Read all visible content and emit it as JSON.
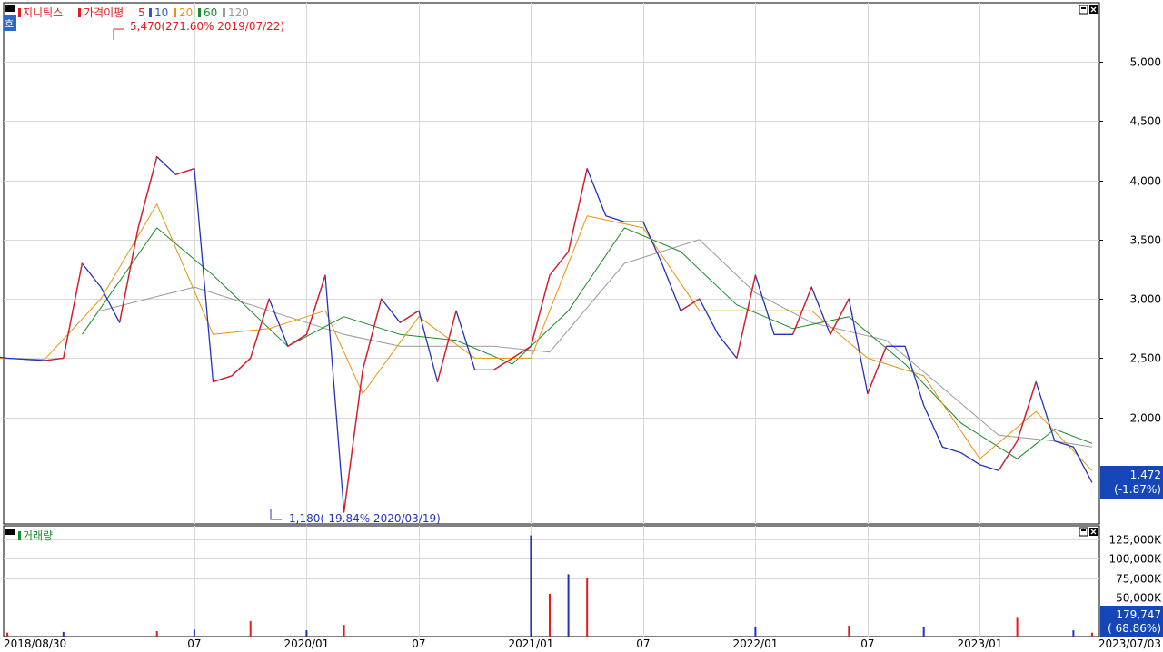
{
  "price_panel": {
    "title": "지니틱스",
    "indicator_label": "가격이평",
    "ma_labels": [
      "5",
      "10",
      "20",
      "60",
      "120"
    ],
    "side_label": "호",
    "high_annotation": "5,470(271.60% 2019/07/22)",
    "low_annotation": "1,180(-19.84% 2020/03/19)",
    "last_price": "1,472",
    "last_change": "(-1.87%)"
  },
  "volume_panel": {
    "title": "거래량",
    "last_volume": "179,747",
    "last_volume_pct": "( 68.86%)"
  },
  "colors": {
    "up": "#e8191e",
    "down": "#2233bb",
    "ma5": "#3355cc",
    "ma10": "#3355cc",
    "ma20": "#e8930c",
    "ma60": "#1a8a2a",
    "ma120": "#999999",
    "badge": "#1547b8",
    "grid": "#d9d9d9"
  },
  "chart_data": [
    {
      "type": "line",
      "title": "지니틱스",
      "ylim": [
        1100,
        5500
      ],
      "y_ticks": [
        2000,
        2500,
        3000,
        3500,
        4000,
        4500,
        5000
      ],
      "y_tick_labels": [
        "2,000",
        "2,500",
        "3,000",
        "3,500",
        "4,000",
        "4,500",
        "5,000"
      ],
      "x_tick_labels": [
        "2018/08/30",
        "07",
        "2020/01",
        "07",
        "2021/01",
        "07",
        "2022/01",
        "07",
        "2023/01",
        "2023/07/03"
      ],
      "grid": true,
      "series": [
        {
          "name": "5",
          "x": [
            "2018/08",
            "2018/09",
            "2018/10",
            "2018/11",
            "2018/12",
            "2019/01",
            "2019/02",
            "2019/03",
            "2019/04",
            "2019/05",
            "2019/06",
            "2019/07",
            "2019/08",
            "2019/09",
            "2019/10",
            "2019/11",
            "2019/12",
            "2020/01",
            "2020/02",
            "2020/03",
            "2020/04",
            "2020/05",
            "2020/06",
            "2020/07",
            "2020/08",
            "2020/09",
            "2020/10",
            "2020/11",
            "2020/12",
            "2021/01",
            "2021/02",
            "2021/03",
            "2021/04",
            "2021/05",
            "2021/06",
            "2021/07",
            "2021/08",
            "2021/09",
            "2021/10",
            "2021/11",
            "2021/12",
            "2022/01",
            "2022/02",
            "2022/03",
            "2022/04",
            "2022/05",
            "2022/06",
            "2022/07",
            "2022/08",
            "2022/09",
            "2022/10",
            "2022/11",
            "2022/12",
            "2023/01",
            "2023/02",
            "2023/03",
            "2023/04",
            "2023/05",
            "2023/06",
            "2023/07"
          ],
          "values": [
            2520,
            2500,
            2490,
            2480,
            2500,
            3300,
            3100,
            2800,
            3600,
            4200,
            4050,
            4100,
            2300,
            2350,
            2500,
            3000,
            2600,
            2700,
            3200,
            1200,
            2400,
            3000,
            2800,
            2900,
            2300,
            2900,
            2400,
            2400,
            2500,
            2600,
            3200,
            3400,
            4100,
            3700,
            3650,
            3650,
            3300,
            2900,
            3000,
            2700,
            2500,
            3200,
            2700,
            2700,
            3100,
            2700,
            3000,
            2200,
            2600,
            2600,
            2100,
            1750,
            1700,
            1600,
            1550,
            1800,
            2300,
            1800,
            1750,
            1450
          ]
        },
        {
          "name": "20",
          "x": [
            "2018/08",
            "2018/11",
            "2019/02",
            "2019/05",
            "2019/08",
            "2019/11",
            "2020/02",
            "2020/04",
            "2020/07",
            "2020/10",
            "2021/01",
            "2021/04",
            "2021/07",
            "2021/10",
            "2022/01",
            "2022/04",
            "2022/07",
            "2022/10",
            "2023/01",
            "2023/04",
            "2023/07"
          ],
          "values": [
            2500,
            2490,
            3000,
            3800,
            2700,
            2750,
            2900,
            2200,
            2850,
            2500,
            2500,
            3700,
            3600,
            2900,
            2900,
            2900,
            2500,
            2350,
            1650,
            2050,
            1550
          ]
        },
        {
          "name": "60",
          "x": [
            "2019/01",
            "2019/05",
            "2019/08",
            "2019/12",
            "2020/03",
            "2020/06",
            "2020/09",
            "2020/12",
            "2021/03",
            "2021/06",
            "2021/09",
            "2021/12",
            "2022/03",
            "2022/06",
            "2022/09",
            "2022/12",
            "2023/03",
            "2023/05",
            "2023/07"
          ],
          "values": [
            2700,
            3600,
            3200,
            2600,
            2850,
            2700,
            2650,
            2450,
            2900,
            3600,
            3400,
            2950,
            2750,
            2850,
            2450,
            1950,
            1650,
            1900,
            1780
          ]
        },
        {
          "name": "120",
          "x": [
            "2019/02",
            "2019/07",
            "2019/11",
            "2020/03",
            "2020/06",
            "2020/11",
            "2021/02",
            "2021/06",
            "2021/10",
            "2022/01",
            "2022/04",
            "2022/08",
            "2022/11",
            "2023/02",
            "2023/05",
            "2023/07"
          ],
          "values": [
            2900,
            3100,
            2900,
            2700,
            2600,
            2600,
            2550,
            3300,
            3500,
            3050,
            2800,
            2650,
            2250,
            1850,
            1800,
            1750
          ]
        }
      ]
    },
    {
      "type": "bar",
      "title": "거래량",
      "unit": "K",
      "ylim": [
        0,
        140000
      ],
      "y_ticks": [
        50000,
        75000,
        100000,
        125000
      ],
      "y_tick_labels": [
        "50,000K",
        "75,000K",
        "100,000K",
        "125,000K"
      ],
      "categories": [
        "2018/09",
        "2018/12",
        "2019/05",
        "2019/07",
        "2019/10",
        "2020/01",
        "2020/03",
        "2021/01",
        "2021/02",
        "2021/03",
        "2021/04",
        "2022/01",
        "2022/06",
        "2022/10",
        "2023/03",
        "2023/06",
        "2023/07"
      ],
      "values": [
        5000,
        6000,
        7000,
        9000,
        20000,
        8000,
        15000,
        130000,
        55000,
        80000,
        75000,
        13000,
        14000,
        13000,
        24000,
        8000,
        5000
      ]
    }
  ]
}
